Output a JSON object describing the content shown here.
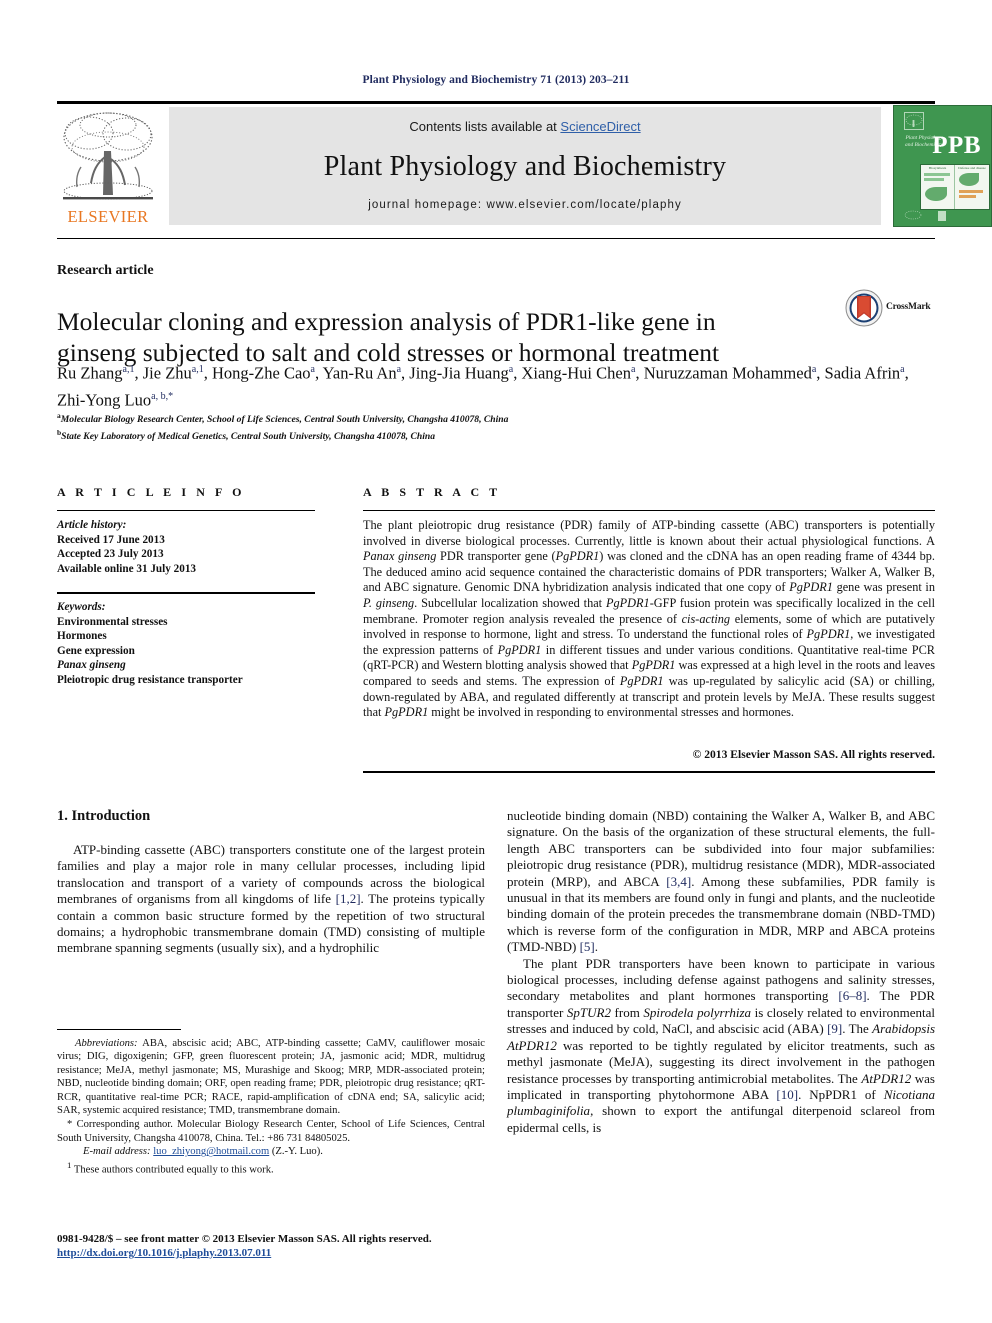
{
  "running_head": "Plant Physiology and Biochemistry 71 (2013) 203–211",
  "masthead": {
    "contents_prefix": "Contents lists available at ",
    "contents_link": "ScienceDirect",
    "journal_title": "Plant Physiology and Biochemistry",
    "homepage": "journal homepage: www.elsevier.com/locate/plaphy",
    "publisher_logo_text": "ELSEVIER",
    "cover_mark": "PPB",
    "cover_subtitle": "Plant Physiology and Biochemistry",
    "cover_fig_left_caption": "Biosynthesis",
    "cover_fig_right_caption": "Defense and disease",
    "accent_green": "#3f9650",
    "accent_orange": "#e87722",
    "link_blue": "#2f5fa8"
  },
  "article": {
    "type": "Research article",
    "title": "Molecular cloning and expression analysis of PDR1-like gene in ginseng subjected to salt and cold stresses or hormonal treatment",
    "crossmark_label": "CrossMark"
  },
  "authors": {
    "list": [
      {
        "name": "Ru Zhang",
        "sup": "a,1",
        "sep": ", "
      },
      {
        "name": "Jie Zhu",
        "sup": "a,1",
        "sep": ", "
      },
      {
        "name": "Hong-Zhe Cao",
        "sup": "a",
        "sep": ", "
      },
      {
        "name": "Yan-Ru An",
        "sup": "a",
        "sep": ", "
      },
      {
        "name": "Jing-Jia Huang",
        "sup": "a",
        "sep": ", "
      },
      {
        "name": "Xiang-Hui Chen",
        "sup": "a",
        "sep": ", "
      },
      {
        "name": "Nuruzzaman Mohammed",
        "sup": "a",
        "sep": ", "
      },
      {
        "name": "Sadia Afrin",
        "sup": "a",
        "sep": ", "
      },
      {
        "name": "Zhi-Yong Luo",
        "sup": "a, b,*",
        "sep": ""
      }
    ],
    "affiliations": [
      {
        "mark": "a",
        "text": "Molecular Biology Research Center, School of Life Sciences, Central South University, Changsha 410078, China"
      },
      {
        "mark": "b",
        "text": "State Key Laboratory of Medical Genetics, Central South University, Changsha 410078, China"
      }
    ]
  },
  "article_info": {
    "section_label": "A R T I C L E   I N F O",
    "history_label": "Article history:",
    "history": [
      "Received 17 June 2013",
      "Accepted 23 July 2013",
      "Available online 31 July 2013"
    ],
    "keywords_label": "Keywords:",
    "keywords": [
      "Environmental stresses",
      "Hormones",
      "Gene expression",
      "Panax ginseng",
      "Pleiotropic drug resistance transporter"
    ],
    "keyword_italic_index": 3
  },
  "abstract": {
    "section_label": "A B S T R A C T",
    "text": "The plant pleiotropic drug resistance (PDR) family of ATP-binding cassette (ABC) transporters is potentially involved in diverse biological processes. Currently, little is known about their actual physiological functions. A Panax ginseng PDR transporter gene (PgPDR1) was cloned and the cDNA has an open reading frame of 4344 bp. The deduced amino acid sequence contained the characteristic domains of PDR transporters; Walker A, Walker B, and ABC signature. Genomic DNA hybridization analysis indicated that one copy of PgPDR1 gene was present in P. ginseng. Subcellular localization showed that PgPDR1-GFP fusion protein was specifically localized in the cell membrane. Promoter region analysis revealed the presence of cis-acting elements, some of which are putatively involved in response to hormone, light and stress. To understand the functional roles of PgPDR1, we investigated the expression patterns of PgPDR1 in different tissues and under various conditions. Quantitative real-time PCR (qRT-PCR) and Western blotting analysis showed that PgPDR1 was expressed at a high level in the roots and leaves compared to seeds and stems. The expression of PgPDR1 was up-regulated by salicylic acid (SA) or chilling, down-regulated by ABA, and regulated differently at transcript and protein levels by MeJA. These results suggest that PgPDR1 might be involved in responding to environmental stresses and hormones.",
    "copyright": "© 2013 Elsevier Masson SAS. All rights reserved."
  },
  "body": {
    "section_number_title": "1.  Introduction",
    "left_paragraphs": [
      "ATP-binding cassette (ABC) transporters constitute one of the largest protein families and play a major role in many cellular processes, including lipid translocation and transport of a variety of compounds across the biological membranes of organisms from all kingdoms of life [1,2]. The proteins typically contain a common basic structure formed by the repetition of two structural domains; a hydrophobic transmembrane domain (TMD) consisting of multiple membrane spanning segments (usually six), and a hydrophilic"
    ],
    "right_paragraphs": [
      "nucleotide binding domain (NBD) containing the Walker A, Walker B, and ABC signature. On the basis of the organization of these structural elements, the full-length ABC transporters can be subdivided into four major subfamilies: pleiotropic drug resistance (PDR), multidrug resistance (MDR), MDR-associated protein (MRP), and ABCA [3,4]. Among these subfamilies, PDR family is unusual in that its members are found only in fungi and plants, and the nucleotide binding domain of the protein precedes the transmembrane domain (NBD-TMD) which is reverse form of the configuration in MDR, MRP and ABCA proteins (TMD-NBD) [5].",
      "The plant PDR transporters have been known to participate in various biological processes, including defense against pathogens and salinity stresses, secondary metabolites and plant hormones transporting [6–8]. The PDR transporter SpTUR2 from Spirodela polyrrhiza is closely related to environmental stresses and induced by cold, NaCl, and abscisic acid (ABA) [9]. The Arabidopsis AtPDR12 was reported to be tightly regulated by elicitor treatments, such as methyl jasmonate (MeJA), suggesting its direct involvement in the pathogen resistance processes by transporting antimicrobial metabolites. The AtPDR12 was implicated in transporting phytohormone ABA [10]. NpPDR1 of Nicotiana plumbaginifolia, shown to export the antifungal diterpenoid sclareol from epidermal cells, is"
    ]
  },
  "footnotes": {
    "abbreviations_label": "Abbreviations:",
    "abbreviations_text": "ABA, abscisic acid; ABC, ATP-binding cassette; CaMV, cauliflower mosaic virus; DIG, digoxigenin; GFP, green fluorescent protein; JA, jasmonic acid; MDR, multidrug resistance; MeJA, methyl jasmonate; MS, Murashige and Skoog; MRP, MDR-associated protein; NBD, nucleotide binding domain; ORF, open reading frame; PDR, pleiotropic drug resistance; qRT-RCR, quantitative real-time PCR; RACE, rapid-amplification of cDNA end; SA, salicylic acid; SAR, systemic acquired resistance; TMD, transmembrane domain.",
    "corresponding_marker": "*",
    "corresponding_text": "Corresponding author. Molecular Biology Research Center, School of Life Sciences, Central South University, Changsha 410078, China. Tel.: +86 731 84805025.",
    "email_label": "E-mail address:",
    "email_value": "luo_zhiyong@hotmail.com",
    "email_suffix": "(Z.-Y. Luo).",
    "equal_marker": "1",
    "equal_text": "These authors contributed equally to this work."
  },
  "imprint": {
    "issn_line": "0981-9428/$ – see front matter © 2013 Elsevier Masson SAS. All rights reserved.",
    "doi": "http://dx.doi.org/10.1016/j.plaphy.2013.07.011"
  }
}
